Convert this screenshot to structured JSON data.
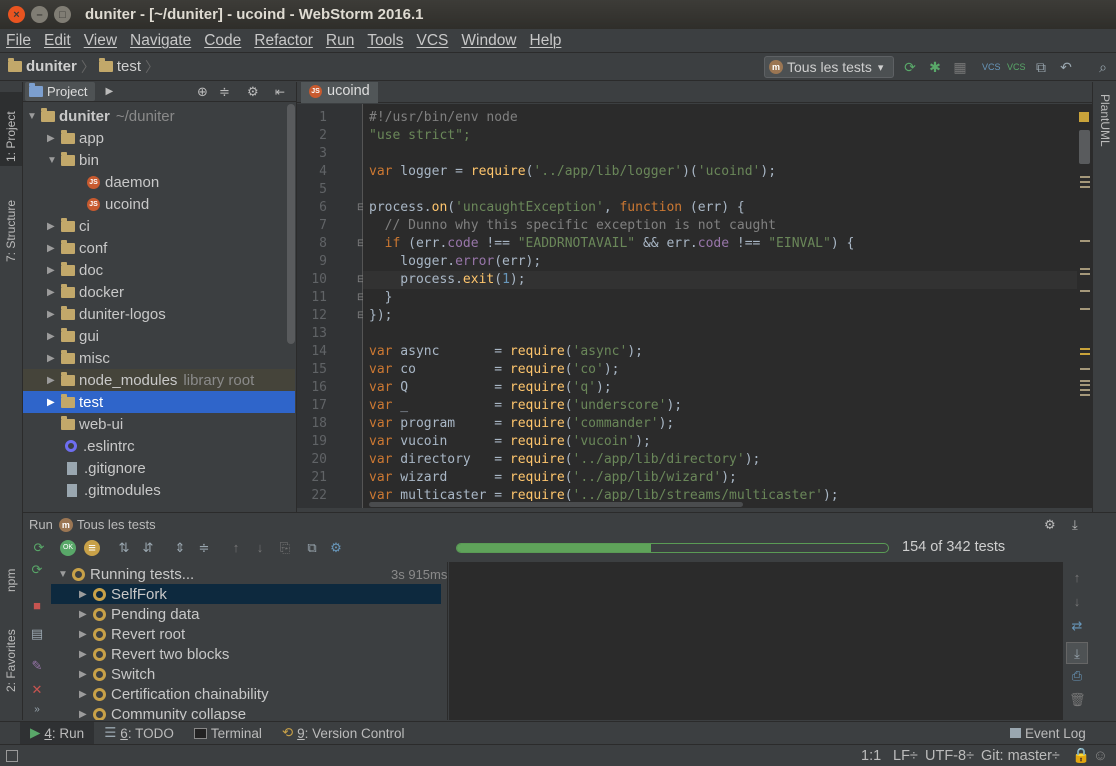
{
  "window": {
    "title": "duniter - [~/duniter] - ucoind - WebStorm 2016.1",
    "close_glyph": "×",
    "minimize_glyph": "–",
    "maximize_glyph": "□"
  },
  "menu": [
    "File",
    "Edit",
    "View",
    "Navigate",
    "Code",
    "Refactor",
    "Run",
    "Tools",
    "VCS",
    "Window",
    "Help"
  ],
  "breadcrumb": [
    "duniter",
    "test"
  ],
  "run_config": {
    "label": "Tous les tests",
    "arrow": "▾"
  },
  "left_strip": {
    "project": "1: Project",
    "structure": "7: Structure",
    "npm": "npm",
    "favorites": "2: Favorites"
  },
  "right_strip": {
    "plantuml": "PlantUML"
  },
  "project_panel": {
    "tab_label": "Project",
    "tree": [
      {
        "label": "duniter",
        "hint": "~/duniter",
        "type": "folder",
        "expanded": true
      },
      {
        "label": "app",
        "type": "folder"
      },
      {
        "label": "bin",
        "type": "folder",
        "expanded": true
      },
      {
        "label": "daemon",
        "type": "js"
      },
      {
        "label": "ucoind",
        "type": "js"
      },
      {
        "label": "ci",
        "type": "folder"
      },
      {
        "label": "conf",
        "type": "folder"
      },
      {
        "label": "doc",
        "type": "folder"
      },
      {
        "label": "docker",
        "type": "folder"
      },
      {
        "label": "duniter-logos",
        "type": "folder"
      },
      {
        "label": "gui",
        "type": "folder"
      },
      {
        "label": "misc",
        "type": "folder"
      },
      {
        "label": "node_modules",
        "hint": "library root",
        "type": "folder"
      },
      {
        "label": "test",
        "type": "folder",
        "selected": true
      },
      {
        "label": "web-ui",
        "type": "folder"
      },
      {
        "label": ".eslintrc",
        "type": "eslint"
      },
      {
        "label": ".gitignore",
        "type": "txt"
      },
      {
        "label": ".gitmodules",
        "type": "txt"
      }
    ]
  },
  "editor": {
    "tab_label": "ucoind",
    "lines": [
      "#!/usr/bin/env node",
      "\"use strict\";",
      "",
      "var logger = require('../app/lib/logger')('ucoind');",
      "",
      "process.on('uncaughtException', function (err) {",
      "  // Dunno why this specific exception is not caught",
      "  if (err.code !== \"EADDRNOTAVAIL\" && err.code !== \"EINVAL\") {",
      "    logger.error(err);",
      "    process.exit(1);",
      "  }",
      "});",
      "",
      "var async       = require('async');",
      "var co          = require('co');",
      "var Q           = require('q');",
      "var _           = require('underscore');",
      "var program     = require('commander');",
      "var vucoin      = require('vucoin');",
      "var directory   = require('../app/lib/directory');",
      "var wizard      = require('../app/lib/wizard');",
      "var multicaster = require('../app/lib/streams/multicaster');"
    ],
    "line_numbers": [
      "1",
      "2",
      "3",
      "4",
      "5",
      "6",
      "7",
      "8",
      "9",
      "10",
      "11",
      "12",
      "13",
      "14",
      "15",
      "16",
      "17",
      "18",
      "19",
      "20",
      "21",
      "22"
    ]
  },
  "run_panel": {
    "label": "Run",
    "config": "Tous les tests",
    "progress_percent": 45,
    "progress_text": "154 of 342 tests",
    "running": {
      "label": "Running tests...",
      "time": "3s 915ms"
    },
    "tests": [
      "SelfFork",
      "Pending data",
      "Revert root",
      "Revert two blocks",
      "Switch",
      "Certification chainability",
      "Community collapse"
    ]
  },
  "bottom_tabs": [
    {
      "num": "4",
      "label": ": Run"
    },
    {
      "num": "6",
      "label": ": TODO"
    },
    {
      "num": "",
      "label": "Terminal"
    },
    {
      "num": "9",
      "label": ": Version Control"
    }
  ],
  "event_log": "Event Log",
  "status": {
    "position": "1:1",
    "line_sep": "LF÷",
    "encoding": "UTF-8÷",
    "git": "Git: master÷"
  },
  "colors": {
    "selection": "#2f65ca",
    "progress": "#5fa35a",
    "keyword": "#cc7832",
    "string": "#6a8759"
  }
}
